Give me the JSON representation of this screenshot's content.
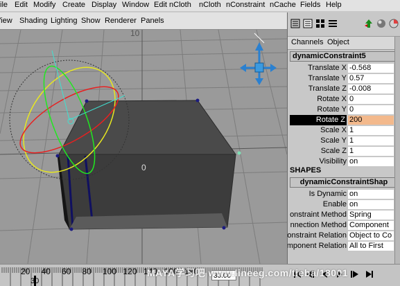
{
  "menubar": {
    "items": [
      "ile",
      "Edit",
      "Modify",
      "Create",
      "Display",
      "Window",
      "Edit nCloth",
      "nCloth",
      "nConstraint",
      "nCache",
      "Fields",
      "Help"
    ]
  },
  "viewport": {
    "menu": [
      "View",
      "Shading",
      "Lighting",
      "Show",
      "Renderer",
      "Panels"
    ],
    "grid_label_top": "10",
    "center_label": "0"
  },
  "panel": {
    "tabs": [
      "Channels",
      "Object"
    ],
    "object_name": "dynamicConstraint5",
    "channels": [
      {
        "label": "Translate X",
        "value": "-0.568"
      },
      {
        "label": "Translate Y",
        "value": "0.57"
      },
      {
        "label": "Translate Z",
        "value": "-0.008"
      },
      {
        "label": "Rotate X",
        "value": "0"
      },
      {
        "label": "Rotate Y",
        "value": "0"
      },
      {
        "label": "Rotate Z",
        "value": "200",
        "selected": true
      },
      {
        "label": "Scale X",
        "value": "1"
      },
      {
        "label": "Scale Y",
        "value": "1"
      },
      {
        "label": "Scale Z",
        "value": "1"
      },
      {
        "label": "Visibility",
        "value": "on"
      }
    ],
    "shapes_title": "SHAPES",
    "shape_name": "dynamicConstraintShap",
    "shape_attrs": [
      {
        "label": "Is Dynamic",
        "value": "on"
      },
      {
        "label": "Enable",
        "value": "on"
      },
      {
        "label": "onstraint Method",
        "value": "Spring"
      },
      {
        "label": "nnection Method",
        "value": "Component"
      },
      {
        "label": "onstraint Relation",
        "value": "Object to Co"
      },
      {
        "label": "mponent Relation",
        "value": "All to First"
      }
    ]
  },
  "timeline": {
    "ticks": [
      "20",
      "40",
      "60",
      "80",
      "100",
      "120",
      "140",
      "160",
      "180"
    ],
    "start_label": "30",
    "current_frame": "30.00"
  },
  "watermark": "MAYA学习吧 www.lineeg.com/tieba/18001",
  "colors": {
    "selected_channel_bg": "#000000",
    "selected_value_bg": "#f3b98c",
    "viewport_bg": "#9a9a9a",
    "cube_dark": "#3a3a3a"
  }
}
